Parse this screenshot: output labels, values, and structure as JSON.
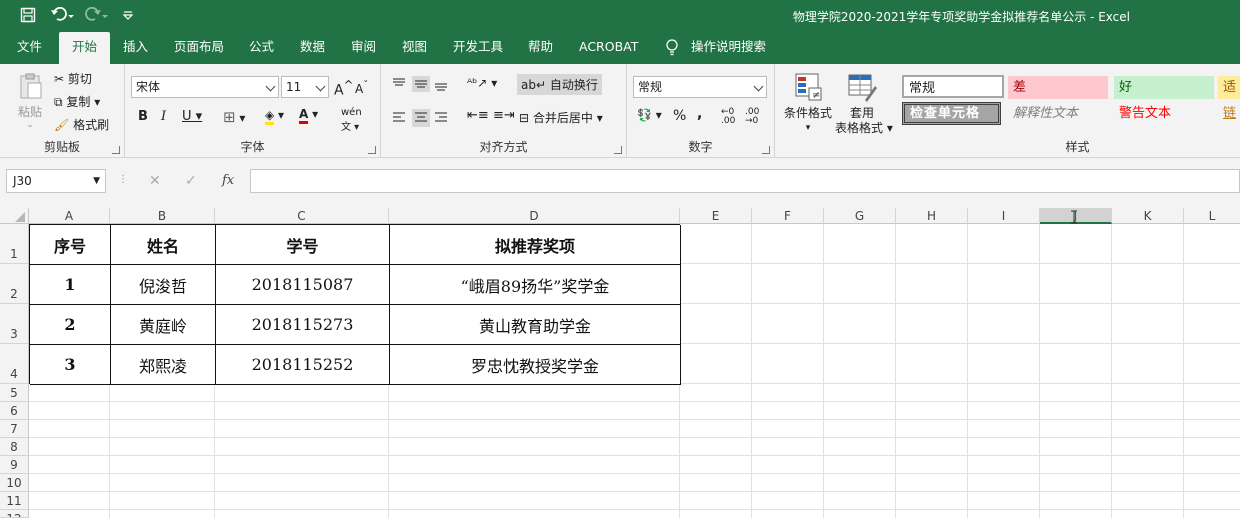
{
  "window": {
    "title": "物理学院2020-2021学年专项奖助学金拟推荐名单公示  -  Excel"
  },
  "quick_access": {
    "save_icon": "save-icon",
    "undo_icon": "undo-icon",
    "redo_icon": "redo-icon",
    "customize_icon": "customize-icon"
  },
  "tabs": [
    "文件",
    "开始",
    "插入",
    "页面布局",
    "公式",
    "数据",
    "审阅",
    "视图",
    "开发工具",
    "帮助",
    "ACROBAT",
    "操作说明搜索"
  ],
  "ribbon": {
    "clipboard": {
      "paste": "粘贴",
      "cut": "剪切",
      "copy": "复制",
      "painter": "格式刷",
      "label": "剪贴板"
    },
    "font": {
      "name": "宋体",
      "size": "11",
      "bold": "B",
      "italic": "I",
      "underline": "U",
      "label": "字体",
      "grow": "A",
      "shrink": "A"
    },
    "align": {
      "wrap": "自动换行",
      "merge": "合并后居中",
      "label": "对齐方式"
    },
    "number": {
      "format": "常规",
      "percent": "%",
      "comma": ",",
      "label": "数字"
    },
    "styles": {
      "cond": "条件格式",
      "table1": "套用",
      "table2": "表格格式",
      "normal": "常规",
      "bad": "差",
      "good": "好",
      "neutral": "适",
      "check": "检查单元格",
      "explain": "解释性文本",
      "warn": "警告文本",
      "link": "链",
      "label": "样式"
    }
  },
  "formula_bar": {
    "name_box": "J30",
    "cancel": "✕",
    "enter": "✓",
    "fx": "fx",
    "value": ""
  },
  "columns": [
    "A",
    "B",
    "C",
    "D",
    "E",
    "F",
    "G",
    "H",
    "I",
    "J",
    "K",
    "L"
  ],
  "rows": [
    "1",
    "2",
    "3",
    "4",
    "5",
    "6",
    "7",
    "8",
    "9",
    "10",
    "11",
    "12"
  ],
  "table": {
    "headers": [
      "序号",
      "姓名",
      "学号",
      "拟推荐奖项"
    ],
    "rows": [
      [
        "1",
        "倪浚哲",
        "2018115087",
        "“峨眉89扬华”奖学金"
      ],
      [
        "2",
        "黄庭岭",
        "2018115273",
        "黄山教育助学金"
      ],
      [
        "3",
        "郑熙凌",
        "2018115252",
        "罗忠忱教授奖学金"
      ]
    ]
  },
  "colors": {
    "accent": "#217346",
    "bad_bg": "#ffc7ce",
    "bad_fg": "#9c0006",
    "good_bg": "#c6efce",
    "good_fg": "#006100",
    "neutral_bg": "#ffeb9c",
    "warn_fg": "#ff0000"
  }
}
